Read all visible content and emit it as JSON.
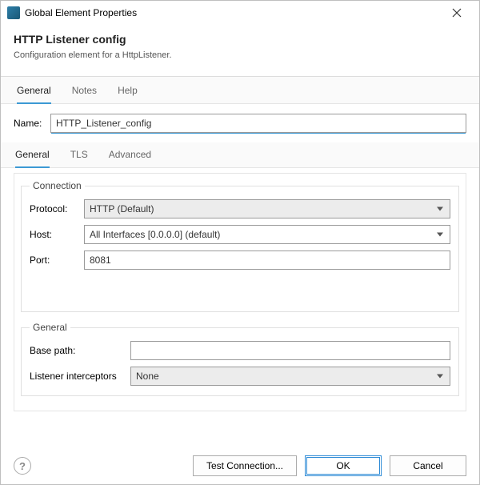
{
  "titlebar": {
    "text": "Global Element Properties"
  },
  "header": {
    "title": "HTTP Listener config",
    "subtitle": "Configuration element for a HttpListener."
  },
  "main_tabs": {
    "general": "General",
    "notes": "Notes",
    "help": "Help"
  },
  "name_row": {
    "label": "Name:",
    "value": "HTTP_Listener_config"
  },
  "sub_tabs": {
    "general": "General",
    "tls": "TLS",
    "advanced": "Advanced"
  },
  "connection_group": {
    "legend": "Connection",
    "protocol_label": "Protocol:",
    "protocol_value": "HTTP (Default)",
    "host_label": "Host:",
    "host_value": "All Interfaces [0.0.0.0] (default)",
    "port_label": "Port:",
    "port_value": "8081"
  },
  "general_group": {
    "legend": "General",
    "basepath_label": "Base path:",
    "basepath_value": "",
    "interceptors_label": "Listener interceptors",
    "interceptors_value": "None"
  },
  "footer": {
    "test": "Test Connection...",
    "ok": "OK",
    "cancel": "Cancel"
  }
}
